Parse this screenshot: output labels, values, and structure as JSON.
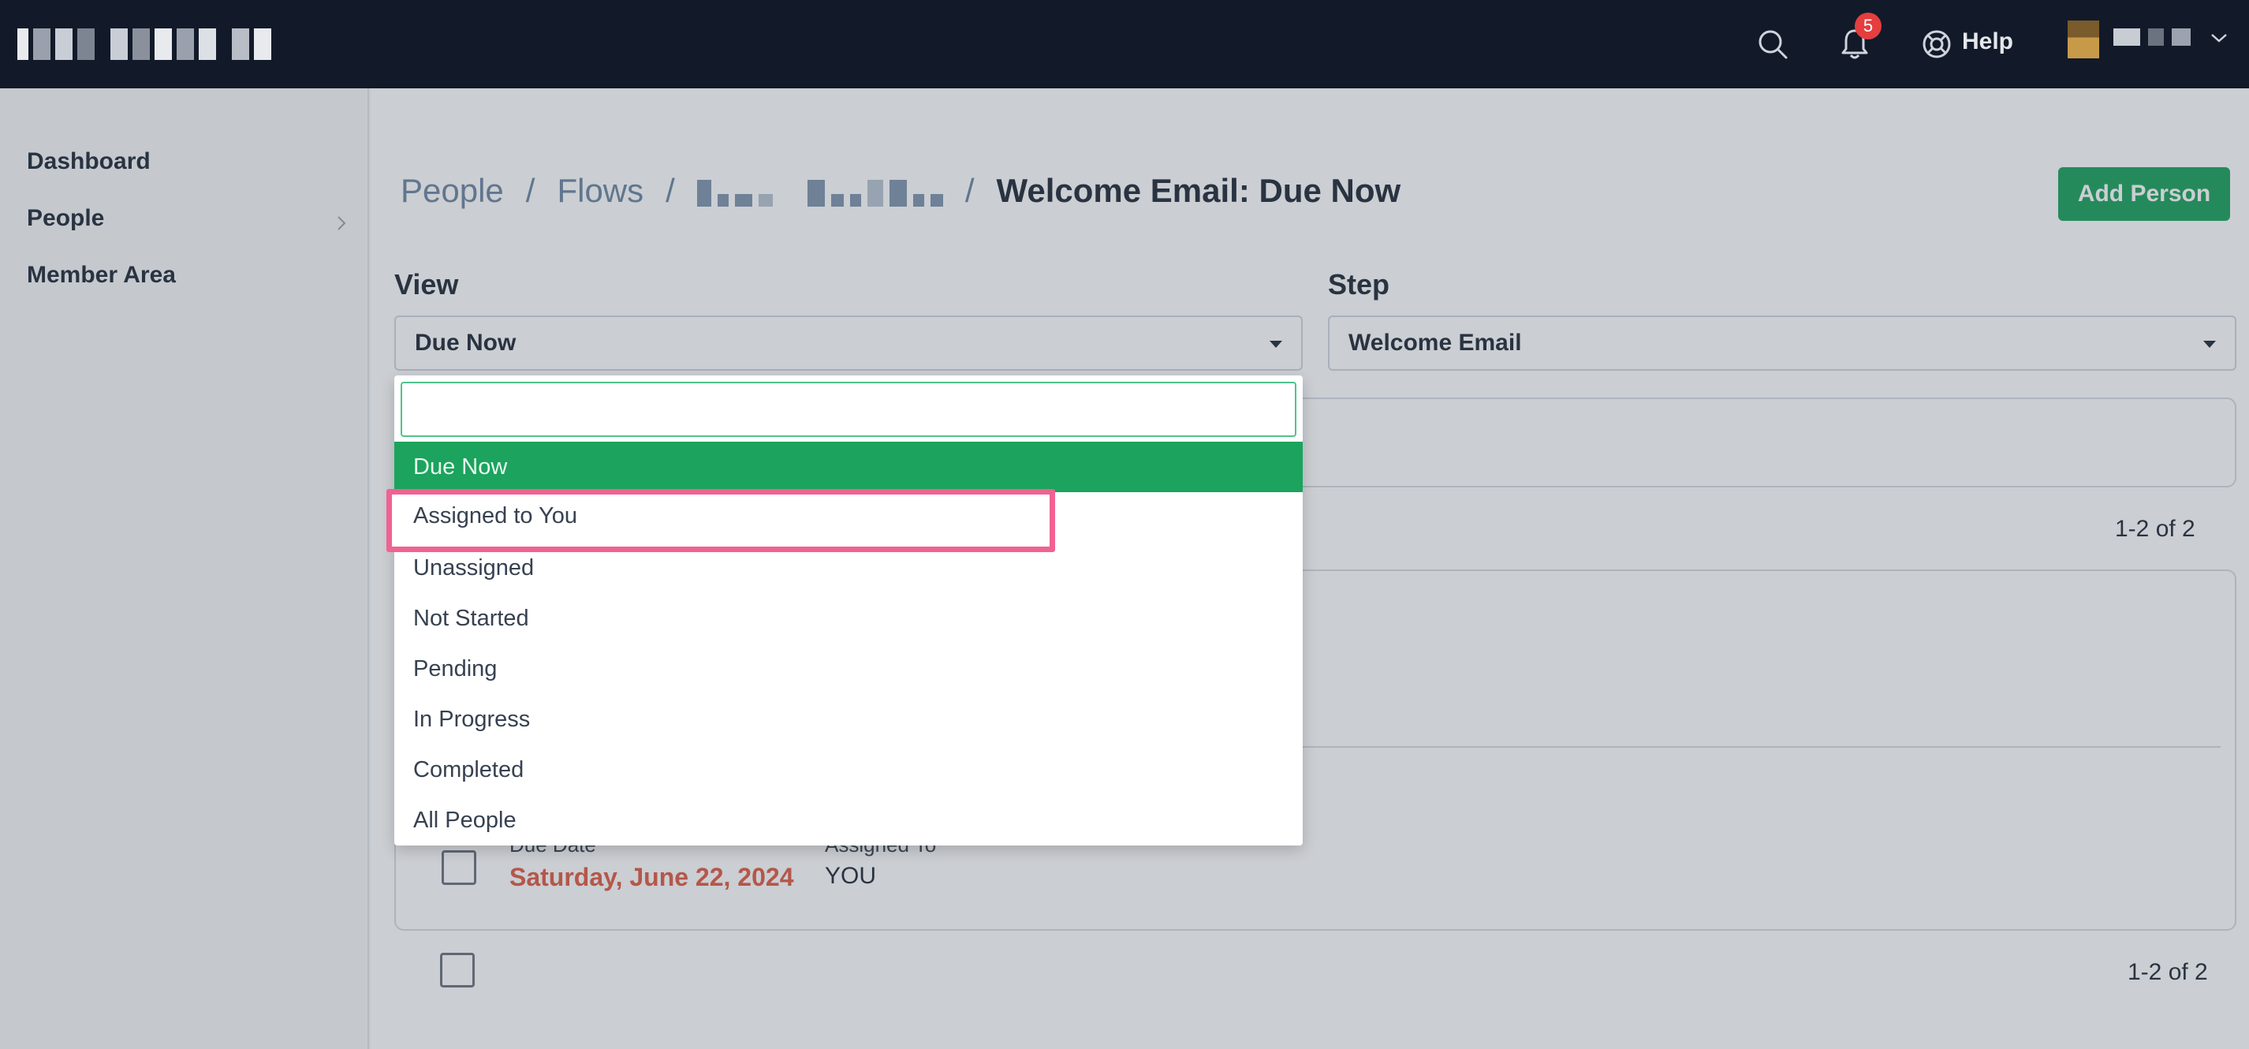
{
  "header": {
    "notifications_count": "5",
    "help_label": "Help",
    "icons": [
      "search-icon",
      "bell-icon",
      "lifebuoy-icon",
      "chevron-down-icon"
    ]
  },
  "sidebar": {
    "items": [
      {
        "label": "Dashboard"
      },
      {
        "label": "People"
      },
      {
        "label": "Member Area"
      }
    ]
  },
  "breadcrumb": {
    "items": [
      "People",
      "Flows"
    ],
    "separator": "/",
    "current": "Welcome Email: Due Now"
  },
  "actions": {
    "add_person": "Add Person"
  },
  "filters": {
    "view_label": "View",
    "view_value": "Due Now",
    "step_label": "Step",
    "step_value": "Welcome Email"
  },
  "view_dropdown": {
    "search_value": "",
    "options": [
      "Due Now",
      "Assigned to You",
      "Unassigned",
      "Not Started",
      "Pending",
      "In Progress",
      "Completed",
      "All People"
    ],
    "selected": "Due Now",
    "highlighted": "Assigned to You"
  },
  "list": {
    "pagination_top": "1-2 of 2",
    "pagination_bottom": "1-2 of 2",
    "row": {
      "due_date_label": "Due Date",
      "due_date": "Saturday, June 22, 2024",
      "assigned_to_label": "Assigned To",
      "assigned_to": "YOU"
    }
  },
  "colors": {
    "topbar": "#121a2a",
    "accent_green": "#19a15b",
    "due_red": "#e05a44",
    "highlight_pink": "#f06292"
  }
}
